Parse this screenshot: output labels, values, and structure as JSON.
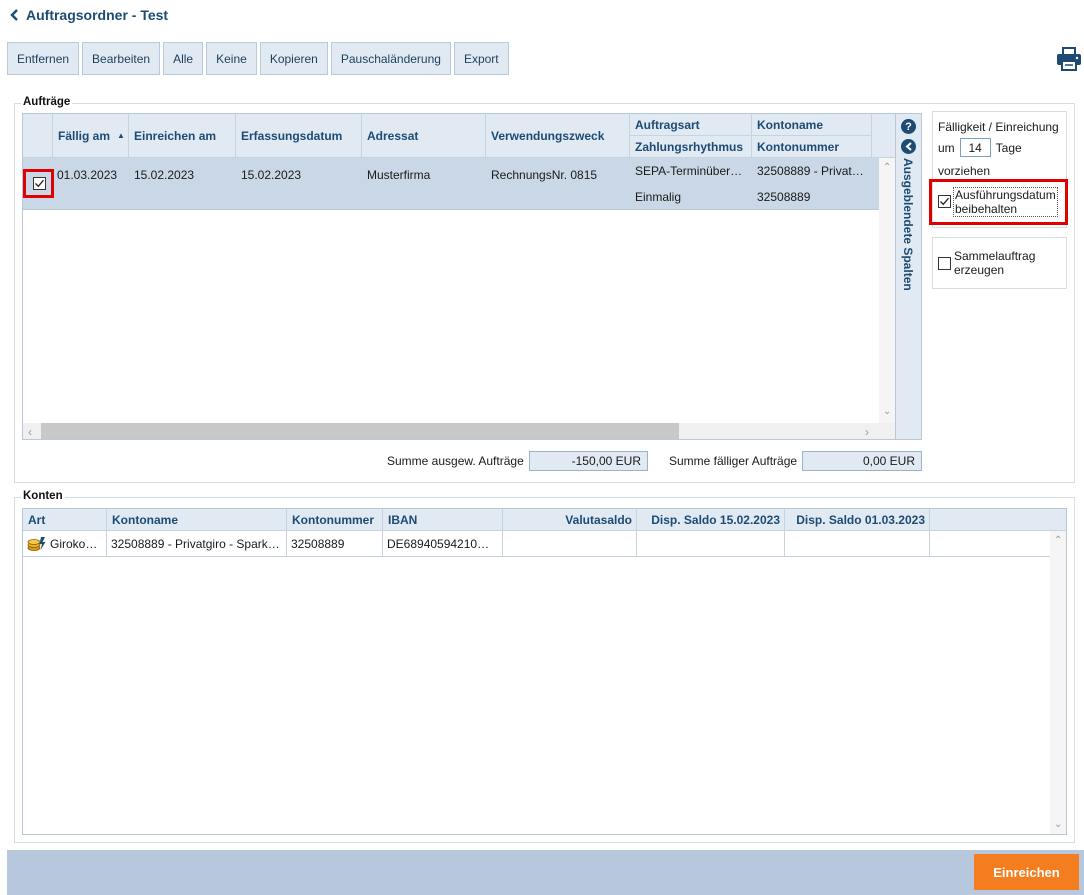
{
  "header": {
    "title": "Auftragsordner - Test"
  },
  "toolbar": {
    "buttons": [
      "Entfernen",
      "Bearbeiten",
      "Alle",
      "Keine",
      "Kopieren",
      "Pauschaländerung",
      "Export"
    ],
    "print_icon": "printer-icon"
  },
  "auftraege": {
    "legend": "Aufträge",
    "columns": {
      "faellig": "Fällig am",
      "einreichen": "Einreichen am",
      "erfassung": "Erfassungsdatum",
      "adressat": "Adressat",
      "zweck": "Verwendungszweck",
      "auftragsart": "Auftragsart",
      "rhythmus": "Zahlungsrhythmus",
      "kontoname": "Kontoname",
      "kontonummer": "Kontonummer"
    },
    "row": {
      "checked": true,
      "faellig": "01.03.2023",
      "einreichen": "15.02.2023",
      "erfassung": "15.02.2023",
      "adressat": "Musterfirma",
      "zweck": "RechnungsNr. 0815",
      "auftragsart": "SEPA-Terminüber…",
      "rhythmus": "Einmalig",
      "kontoname": "32508889 - Privat…",
      "kontonummer": "32508889"
    },
    "hidden_columns_label": "Ausgeblendete Spalten",
    "summe_ausgew_label": "Summe ausgew. Aufträge",
    "summe_ausgew_value": "-150,00 EUR",
    "summe_faellig_label": "Summe fälliger Aufträge",
    "summe_faellig_value": "0,00 EUR"
  },
  "options": {
    "faelligkeit_title": "Fälligkeit / Einreichung",
    "um": "um",
    "tage_value": "14",
    "tage": "Tage",
    "vorziehen": "vorziehen",
    "ausfuehrung_line1": "Ausführungsdatum",
    "ausfuehrung_line2": "beibehalten",
    "sammel_line1": "Sammelauftrag",
    "sammel_line2": "erzeugen"
  },
  "konten": {
    "legend": "Konten",
    "columns": {
      "art": "Art",
      "kontoname": "Kontoname",
      "kontonummer": "Kontonummer",
      "iban": "IBAN",
      "valutasaldo": "Valutasaldo",
      "disp1": "Disp. Saldo 15.02.2023",
      "disp2": "Disp. Saldo 01.03.2023"
    },
    "row": {
      "icon": "account-coins-icon",
      "art": "Giroko…",
      "kontoname": "32508889 - Privatgiro - Spark…",
      "kontonummer": "32508889",
      "iban": "DE68940594210…"
    }
  },
  "footer": {
    "submit": "Einreichen"
  },
  "colors": {
    "accent": "#1d4b73",
    "header_bg": "#e1e9f2",
    "selected_row": "#cad7e6",
    "submit": "#f47d20",
    "highlight": "#e00000"
  }
}
